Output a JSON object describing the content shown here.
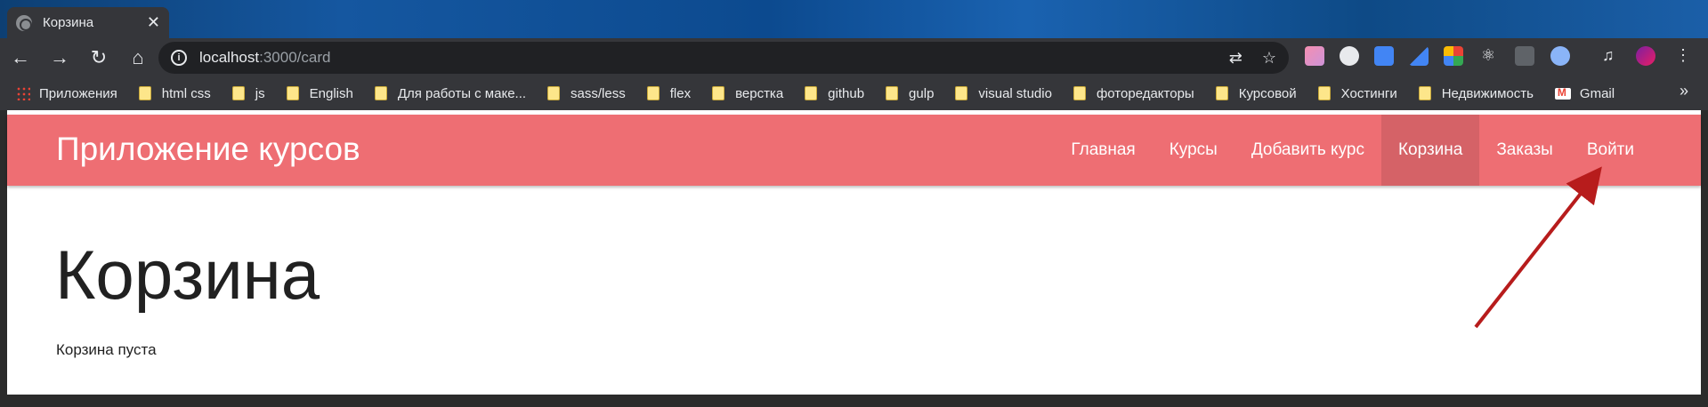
{
  "browser": {
    "tab_title": "Корзина",
    "tab_close": "✕",
    "url_host": "localhost",
    "url_path": ":3000/card"
  },
  "bookmarks": [
    {
      "label": "Приложения",
      "icon": "apps-icon"
    },
    {
      "label": "html css",
      "icon": "folder-icon"
    },
    {
      "label": "js",
      "icon": "folder-icon"
    },
    {
      "label": "English",
      "icon": "folder-icon"
    },
    {
      "label": "Для работы с маке...",
      "icon": "folder-icon"
    },
    {
      "label": "sass/less",
      "icon": "folder-icon"
    },
    {
      "label": "flex",
      "icon": "folder-icon"
    },
    {
      "label": "верстка",
      "icon": "folder-icon"
    },
    {
      "label": "github",
      "icon": "folder-icon"
    },
    {
      "label": "gulp",
      "icon": "folder-icon"
    },
    {
      "label": "visual studio",
      "icon": "folder-icon"
    },
    {
      "label": "фоторедакторы",
      "icon": "folder-icon"
    },
    {
      "label": "Курсовой",
      "icon": "folder-icon"
    },
    {
      "label": "Хостинги",
      "icon": "folder-icon"
    },
    {
      "label": "Недвижимость",
      "icon": "folder-icon"
    },
    {
      "label": "Gmail",
      "icon": "gmail-icon"
    }
  ],
  "bookmarks_more": "»",
  "site": {
    "brand": "Приложение курсов",
    "nav": [
      {
        "label": "Главная"
      },
      {
        "label": "Курсы"
      },
      {
        "label": "Добавить курс"
      },
      {
        "label": "Корзина",
        "active": true
      },
      {
        "label": "Заказы"
      },
      {
        "label": "Войти"
      }
    ],
    "heading": "Корзина",
    "empty_text": "Корзина пуста"
  },
  "colors": {
    "navbar": "#ee6e73",
    "annotation_arrow": "#b71c1c"
  }
}
